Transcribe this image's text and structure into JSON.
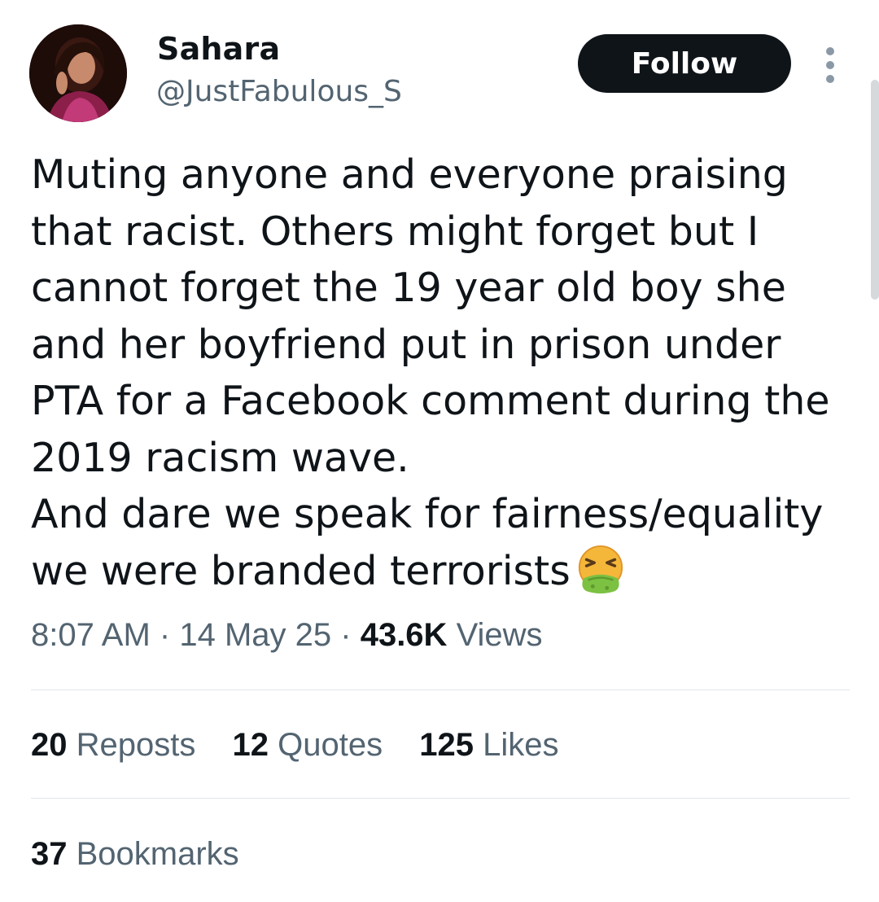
{
  "author": {
    "name": "Sahara",
    "handle": "@JustFabulous_S",
    "avatar_icon": "profile-photo"
  },
  "follow_label": "Follow",
  "more_icon": "more-vertical-icon",
  "tweet": {
    "text": "Muting anyone and everyone praising\nthat racist. Others might forget but I\ncannot forget the 19 year old boy she\nand her boyfriend put in prison under\nPTA for a Facebook comment during the\n2019 racism wave.\nAnd dare we speak for fairness/equality\nwe were branded terrorists",
    "emoji": "face-vomiting-emoji"
  },
  "meta": {
    "time": "8:07 AM",
    "date": "14 May 25",
    "views_count": "43.6K",
    "views_label": "Views",
    "separator": "·"
  },
  "stats": {
    "reposts_count": "20",
    "reposts_label": "Reposts",
    "quotes_count": "12",
    "quotes_label": "Quotes",
    "likes_count": "125",
    "likes_label": "Likes",
    "bookmarks_count": "37",
    "bookmarks_label": "Bookmarks"
  },
  "colors": {
    "text_primary": "#0f1419",
    "text_secondary": "#536471",
    "follow_bg": "#0f1419",
    "divider": "#e1e6ea"
  }
}
